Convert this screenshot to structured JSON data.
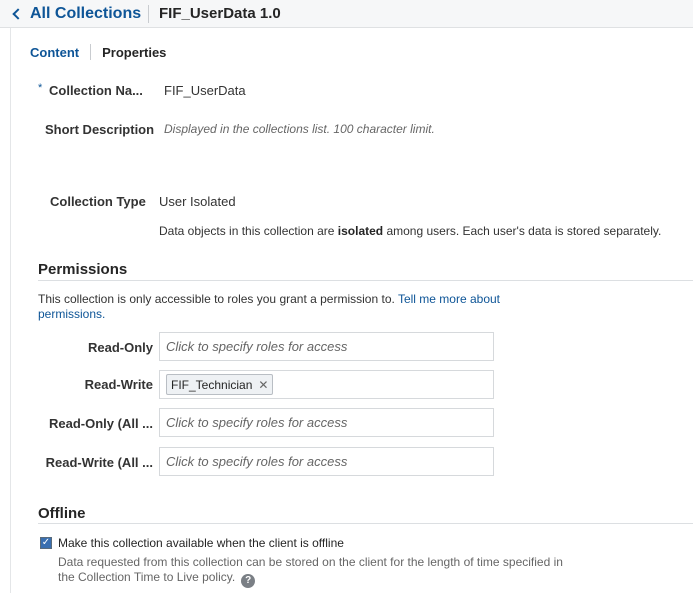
{
  "header": {
    "back_label": "All Collections",
    "title": "FIF_UserData 1.0"
  },
  "tabs": [
    {
      "label": "Content",
      "active": true
    },
    {
      "label": "Properties",
      "active": false
    }
  ],
  "general": {
    "required_marker": "*",
    "collection_name_label": "Collection Na...",
    "collection_name_value": "FIF_UserData",
    "short_description_label": "Short Description",
    "short_description_placeholder": "Displayed in the collections list. 100 character limit.",
    "collection_type_label": "Collection Type",
    "collection_type_value": "User Isolated",
    "type_desc_pre": "Data objects in this collection are ",
    "type_desc_bold": "isolated",
    "type_desc_post": "  among users. Each user's data is stored separately."
  },
  "permissions": {
    "heading": "Permissions",
    "intro": "This collection is only accessible to roles you grant a permission to. ",
    "link": "Tell me more about permissions.",
    "rows": [
      {
        "label": "Read-Only",
        "placeholder": "Click to specify roles for access"
      },
      {
        "label": "Read-Write",
        "chip": "FIF_Technician"
      },
      {
        "label": "Read-Only (All ...",
        "placeholder": "Click to specify roles for access"
      },
      {
        "label": "Read-Write (All ...",
        "placeholder": "Click to specify roles for access"
      }
    ],
    "remove_glyph": "✕"
  },
  "offline": {
    "heading": "Offline",
    "checked": true,
    "check_glyph": "✓",
    "checkbox_label": "Make this collection available when the client is offline",
    "description": "Data requested from this collection can be stored on the client for the length of time specified in the Collection Time to Live policy.",
    "help_glyph": "?"
  },
  "colors": {
    "link": "#0e5597",
    "text": "#333333",
    "hint": "#666666",
    "checkbox": "#3a6fb0"
  },
  "icons": {
    "back": "chevron-left-icon",
    "remove": "close-icon",
    "help": "help-icon",
    "check": "checkmark-icon"
  }
}
